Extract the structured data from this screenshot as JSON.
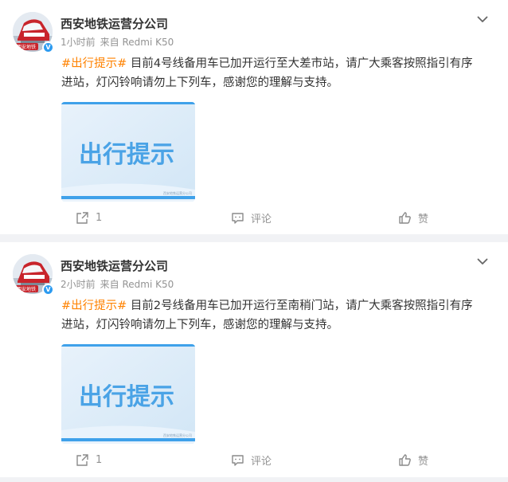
{
  "posts": [
    {
      "author": "西安地铁运营分公司",
      "time": "1小时前",
      "source": "来自 Redmi K50",
      "topic": "#出行提示#",
      "text_line1": " 目前4号线备用车已加开运行至大差市站，请广大乘客按照指引有序",
      "text_line2": "进站，灯闪铃响请勿上下列车，感谢您的理解与支持。",
      "image_text": "出行提示",
      "image_caption": "西安地铁运营分公司",
      "share_count": "1",
      "comment_label": "评论",
      "like_label": "赞",
      "avatar_badge": "西安地铁",
      "verified_badge": "V"
    },
    {
      "author": "西安地铁运营分公司",
      "time": "2小时前",
      "source": "来自 Redmi K50",
      "topic": "#出行提示#",
      "text_line1": " 目前2号线备用车已加开运行至南稍门站，请广大乘客按照指引有序",
      "text_line2": "进站，灯闪铃响请勿上下列车，感谢您的理解与支持。",
      "image_text": "出行提示",
      "image_caption": "西安地铁运营分公司",
      "share_count": "1",
      "comment_label": "评论",
      "like_label": "赞",
      "avatar_badge": "西安地铁",
      "verified_badge": "V"
    }
  ],
  "colors": {
    "topic": "#ff8200",
    "verified": "#2d9bf0",
    "image_bg": "#dcebf8",
    "image_text": "#4aa3e6",
    "image_stripe": "#3fa1ea"
  },
  "icons": {
    "more": "chevron-down-icon",
    "share": "share-icon",
    "comment": "comment-icon",
    "like": "thumbs-up-icon"
  }
}
